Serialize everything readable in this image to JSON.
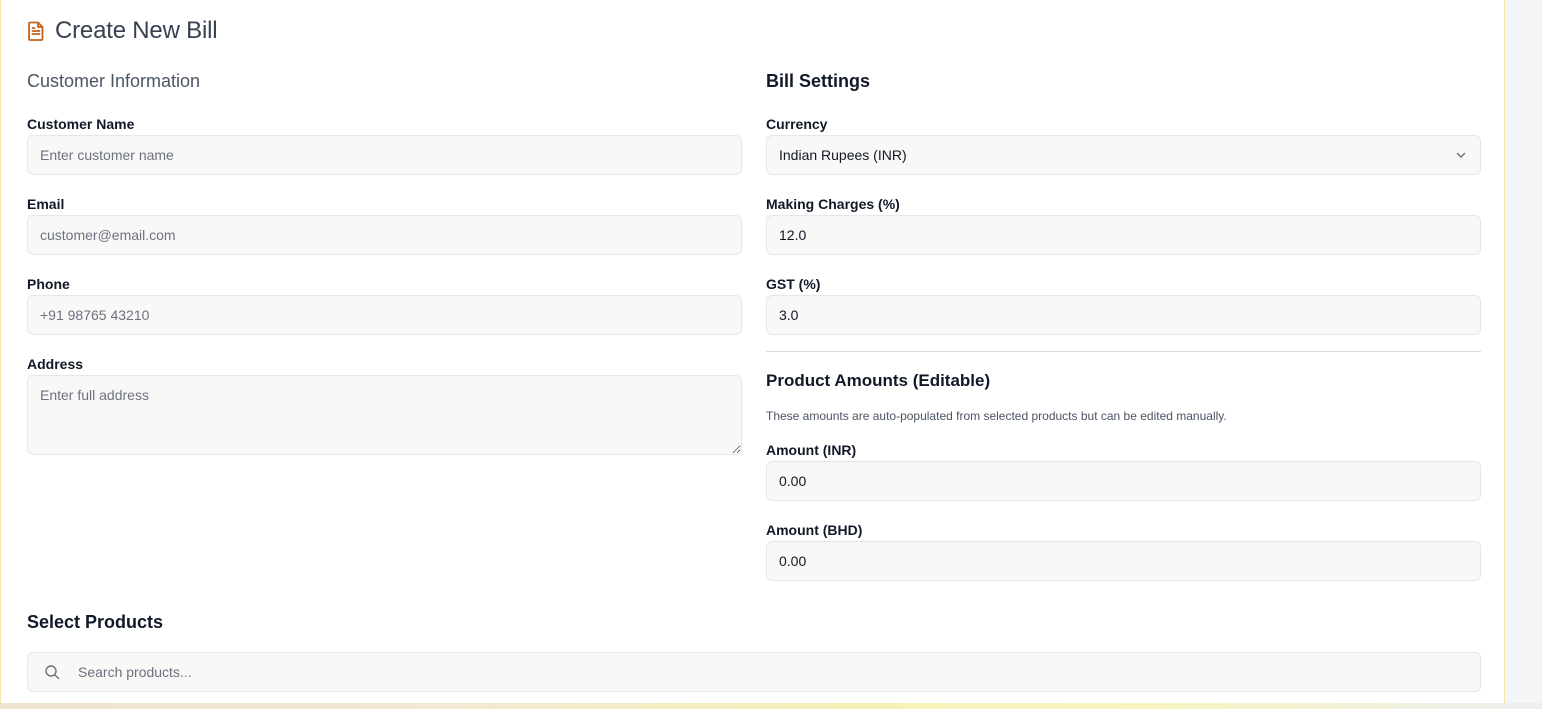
{
  "page": {
    "title": "Create New Bill",
    "icon": "document-icon",
    "accent_color": "#c2621d"
  },
  "customer": {
    "section_title": "Customer Information",
    "name": {
      "label": "Customer Name",
      "placeholder": "Enter customer name",
      "value": ""
    },
    "email": {
      "label": "Email",
      "placeholder": "customer@email.com",
      "value": ""
    },
    "phone": {
      "label": "Phone",
      "placeholder": "+91 98765 43210",
      "value": ""
    },
    "address": {
      "label": "Address",
      "placeholder": "Enter full address",
      "value": ""
    }
  },
  "settings": {
    "section_title": "Bill Settings",
    "currency": {
      "label": "Currency",
      "selected": "Indian Rupees (INR)"
    },
    "making_charges": {
      "label": "Making Charges (%)",
      "value": "12.0"
    },
    "gst": {
      "label": "GST (%)",
      "value": "3.0"
    }
  },
  "amounts": {
    "section_title": "Product Amounts (Editable)",
    "helper": "These amounts are auto-populated from selected products but can be edited manually.",
    "inr": {
      "label": "Amount (INR)",
      "value": "0.00"
    },
    "bhd": {
      "label": "Amount (BHD)",
      "value": "0.00"
    }
  },
  "products": {
    "section_title": "Select Products",
    "search_placeholder": "Search products..."
  }
}
